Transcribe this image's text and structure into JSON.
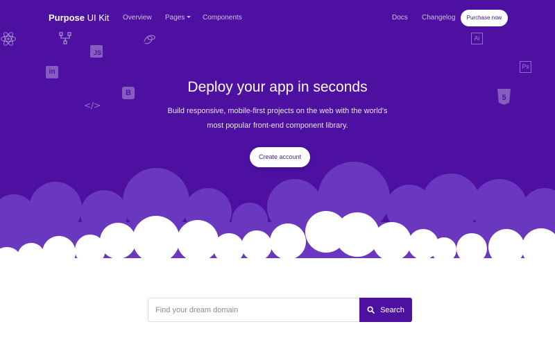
{
  "nav": {
    "brand_bold": "Purpose",
    "brand_rest": " UI Kit",
    "links": [
      {
        "label": "Overview"
      },
      {
        "label": "Pages"
      },
      {
        "label": "Components"
      }
    ],
    "right_links": [
      {
        "label": "Docs"
      },
      {
        "label": "Changelog"
      }
    ],
    "purchase_label": "Purchase now"
  },
  "hero": {
    "title": "Deploy your app in seconds",
    "subtitle_line1": "Build responsive, mobile-first projects on the web with the world's",
    "subtitle_line2": "most popular front-end component library.",
    "cta_label": "Create account"
  },
  "floating_icons": {
    "js": "JS",
    "invision": "in",
    "bootstrap": "B",
    "code": "</>",
    "illustrator": "Ai",
    "photoshop": "Ps",
    "html5": "5"
  },
  "search": {
    "placeholder": "Find your dream domain",
    "button_label": "Search"
  },
  "colors": {
    "primary": "#4d10a1",
    "cloud_back": "#6c3bc2",
    "white": "#ffffff"
  }
}
